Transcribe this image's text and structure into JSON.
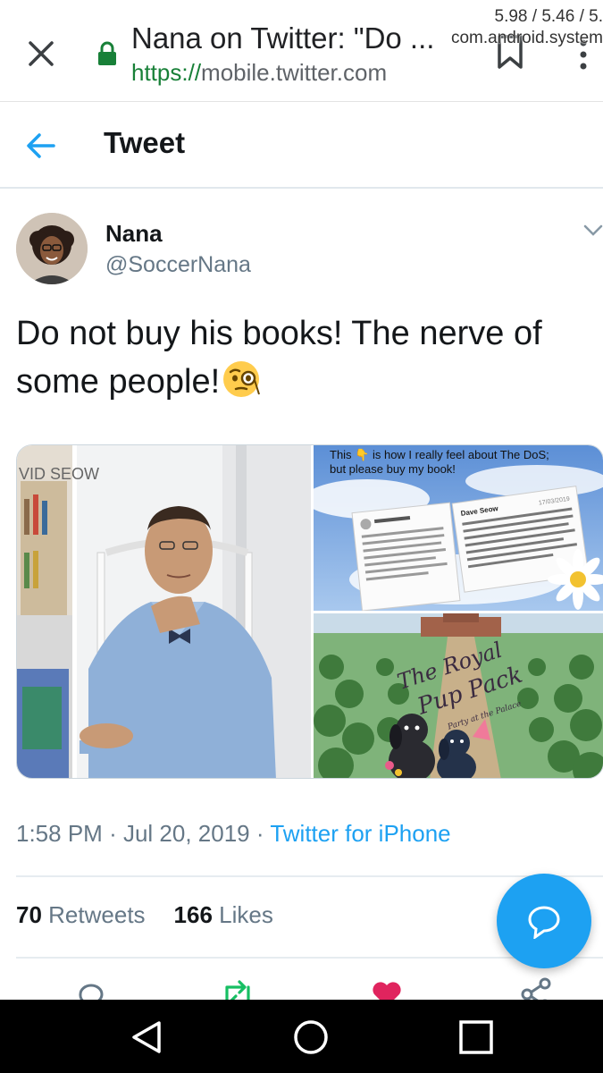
{
  "browser": {
    "page_title": "Nana on Twitter: \"Do ...",
    "url_scheme": "https://",
    "url_host": "mobile.twitter.com",
    "overlay_stats": "5.98 / 5.46 / 5.",
    "overlay_process": "com.android.system"
  },
  "header": {
    "title": "Tweet"
  },
  "tweet": {
    "author_name": "Nana",
    "author_handle": "@SoccerNana",
    "text": "Do not buy his books! The nerve of some people!",
    "emoji": "face-with-monocle-icon",
    "time": "1:58 PM",
    "separator": "·",
    "date": "Jul 20, 2019",
    "source": "Twitter for iPhone",
    "retweets_count": "70",
    "retweets_label": "Retweets",
    "likes_count": "166",
    "likes_label": "Likes"
  },
  "media": {
    "left_caption": "VID SEOW",
    "top_right_caption": "This 👇 is how I really feel about The DoS; but please buy my book!",
    "tweet_card_author": "Dave Seow",
    "tweet_card_date": "17/03/2019",
    "tweet_card_text": "I think for 37 years of an independent life, royal restrictions may seem well difficult at this stage and perhaps she thinks she can affect change. Thing is to her rabid fan base, some of whom can be vicious, she can do no wrong. The UK is not the US. Rules have to be followed!",
    "book_title_line1": "The Royal",
    "book_title_line2": "Pup Pack",
    "book_subtitle": "Party at the Palace"
  },
  "colors": {
    "twitter_blue": "#1da1f2",
    "text_primary": "#14171a",
    "text_secondary": "#657786",
    "lock_green": "#188038",
    "like_red": "#e0245e",
    "retweet_green": "#17bf63"
  }
}
